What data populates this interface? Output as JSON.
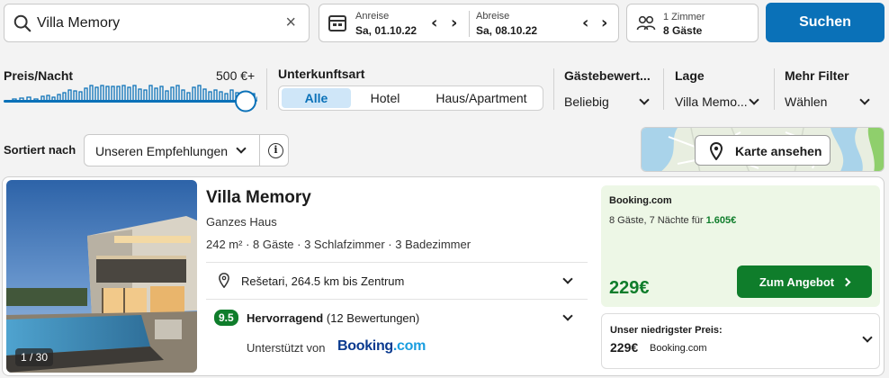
{
  "search": {
    "value": "Villa Memory",
    "clear": "×"
  },
  "dates": {
    "checkin_label": "Anreise",
    "checkin_value": "Sa, 01.10.22",
    "checkout_label": "Abreise",
    "checkout_value": "Sa, 08.10.22",
    "prev": "‹",
    "next": "›"
  },
  "rooms": {
    "rooms_label": "1 Zimmer",
    "guests_label": "8 Gäste"
  },
  "search_button": "Suchen",
  "filters": {
    "price": {
      "label": "Preis/Nacht",
      "max": "500 €+",
      "level": 1.0
    },
    "type": {
      "label": "Unterkunftsart",
      "options": [
        "Alle",
        "Hotel",
        "Haus/Apartment"
      ],
      "selected": "Alle"
    },
    "rating": {
      "label": "Gästebewert...",
      "value": "Beliebig"
    },
    "location": {
      "label": "Lage",
      "value": "Villa Memo..."
    },
    "more": {
      "label": "Mehr Filter",
      "value": "Wählen"
    }
  },
  "sort": {
    "label": "Sortiert nach",
    "value": "Unseren Empfehlungen",
    "info": "i"
  },
  "map": {
    "button": "Karte ansehen"
  },
  "listing": {
    "photo_counter": "1 / 30",
    "title": "Villa Memory",
    "type": "Ganzes Haus",
    "facts": "242 m² · 8 Gäste · 3 Schlafzimmer · 3 Badezimmer",
    "location": "Rešetari, 264.5 km bis Zentrum",
    "rating_score": "9.5",
    "rating_word": "Hervorragend",
    "rating_count": "(12 Bewertungen)",
    "supported_by": "Unterstützt von",
    "partner_logo_main": "Booking",
    "partner_logo_suffix": ".com",
    "offer": {
      "provider": "Booking.com",
      "details_prefix": "8 Gäste, 7 Nächte für",
      "details_total": "1.605€",
      "price": "229€",
      "cta": "Zum Angebot"
    },
    "lowest": {
      "label": "Unser niedrigster Preis:",
      "price": "229€",
      "provider": "Booking.com"
    }
  },
  "colors": {
    "brand_blue": "#0a71b8",
    "deal_green": "#0f7d2b",
    "offer_bg": "#edf7e6"
  }
}
